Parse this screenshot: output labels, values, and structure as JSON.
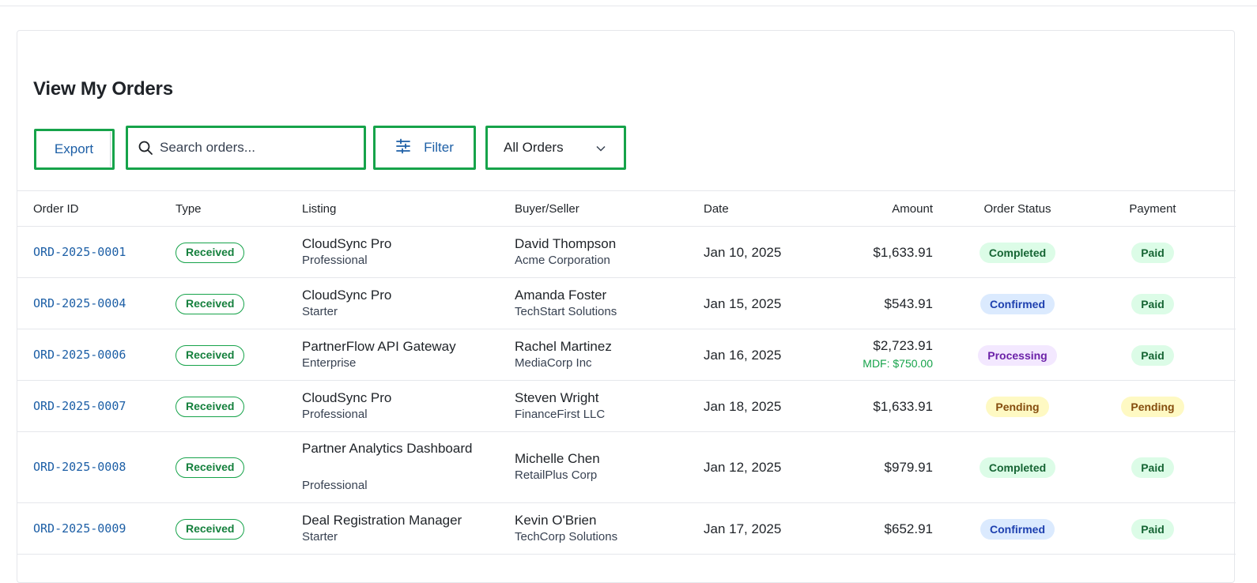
{
  "page": {
    "title": "View My Orders"
  },
  "toolbar": {
    "export_label": "Export",
    "search_placeholder": "Search orders...",
    "filter_label": "Filter",
    "select_value": "All Orders",
    "icons": {
      "search": "search-icon",
      "filter": "sliders-icon",
      "select": "chevron-down-icon"
    }
  },
  "table": {
    "columns": [
      "Order ID",
      "Type",
      "Listing",
      "Buyer/Seller",
      "Date",
      "Amount",
      "Order Status",
      "Payment"
    ],
    "rows": [
      {
        "order_id": "ORD-2025-0001",
        "type": "Received",
        "listing": "CloudSync Pro",
        "tier": "Professional",
        "buyer": "David Thompson",
        "company": "Acme Corporation",
        "date": "Jan 10, 2025",
        "amount": "$1,633.91",
        "mdf": "",
        "status": "Completed",
        "payment": "Paid"
      },
      {
        "order_id": "ORD-2025-0004",
        "type": "Received",
        "listing": "CloudSync Pro",
        "tier": "Starter",
        "buyer": "Amanda Foster",
        "company": "TechStart Solutions",
        "date": "Jan 15, 2025",
        "amount": "$543.91",
        "mdf": "",
        "status": "Confirmed",
        "payment": "Paid"
      },
      {
        "order_id": "ORD-2025-0006",
        "type": "Received",
        "listing": "PartnerFlow API Gateway",
        "tier": "Enterprise",
        "buyer": "Rachel Martinez",
        "company": "MediaCorp Inc",
        "date": "Jan 16, 2025",
        "amount": "$2,723.91",
        "mdf": "MDF: $750.00",
        "status": "Processing",
        "payment": "Paid"
      },
      {
        "order_id": "ORD-2025-0007",
        "type": "Received",
        "listing": "CloudSync Pro",
        "tier": "Professional",
        "buyer": "Steven Wright",
        "company": "FinanceFirst LLC",
        "date": "Jan 18, 2025",
        "amount": "$1,633.91",
        "mdf": "",
        "status": "Pending",
        "payment": "Pending"
      },
      {
        "order_id": "ORD-2025-0008",
        "type": "Received",
        "listing": "Partner Analytics Dashboard",
        "tier": "Professional",
        "buyer": "Michelle Chen",
        "company": "RetailPlus Corp",
        "date": "Jan 12, 2025",
        "amount": "$979.91",
        "mdf": "",
        "status": "Completed",
        "payment": "Paid"
      },
      {
        "order_id": "ORD-2025-0009",
        "type": "Received",
        "listing": "Deal Registration Manager",
        "tier": "Starter",
        "buyer": "Kevin O'Brien",
        "company": "TechCorp Solutions",
        "date": "Jan 17, 2025",
        "amount": "$652.91",
        "mdf": "",
        "status": "Confirmed",
        "payment": "Paid"
      }
    ]
  },
  "colors": {
    "accent": "#1d5fa6",
    "highlight_border": "#16a34a",
    "completed_bg": "#dcfce7",
    "completed_fg": "#166534",
    "confirmed_bg": "#dbeafe",
    "confirmed_fg": "#1e40af",
    "processing_bg": "#f3e8ff",
    "processing_fg": "#6b21a8",
    "pending_bg": "#fef9c3",
    "pending_fg": "#854d0e",
    "paid_bg": "#dcfce7",
    "paid_fg": "#166534"
  }
}
